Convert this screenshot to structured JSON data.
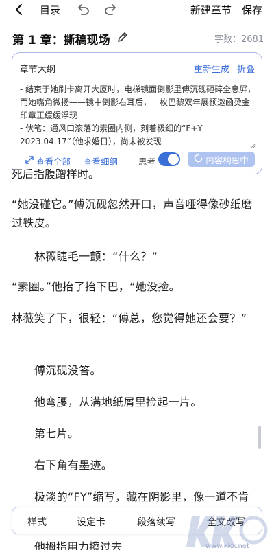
{
  "toolbar": {
    "toc_label": "目录",
    "new_chapter_label": "新建章节",
    "save_label": "保存"
  },
  "chapter": {
    "title": "第 1 章：撕稿现场",
    "word_count_label": "字数：",
    "word_count": "2681"
  },
  "outline": {
    "title": "章节大纲",
    "regenerate_label": "重新生成",
    "fold_label": "折叠",
    "lines": [
      "- 结束于她刷卡离开大厦时，电梯镜面倒影里傅沉砚砸碎全息屏，而她嘴角微扬——镜中倒影右耳后，一枚巴黎双年展预邀函烫金印章正缓缓浮现",
      "- 伏笔：通风口滚落的素圈内侧，刻着极细的“F+Y 2023.04.17”（他求婚日），尚未被发现"
    ],
    "view_all_label": "查看全部",
    "view_detail_label": "查看细纲",
    "think_label": "思考",
    "think_enabled": true,
    "idea_button_label": "内容构思中"
  },
  "body": {
    "cut_line": "死后指腹蹭样时。",
    "paragraphs": [
      "“她没碰它。”傅沉砚忽然开口，声音哑得像砂纸磨过铁皮。",
      "林薇睫毛一颤：“什么？”",
      "“素圈。”他抬了抬下巴，“她没捡。",
      "林薇笑了下，很轻：“傅总，您觉得她还会要？”",
      "傅沉砚没答。",
      "他弯腰，从满地纸屑里捡起一片。",
      "第七片。",
      "右下角有墨迹。",
      "极淡的“FY”缩写，藏在阴影里，像一道不肯"
    ],
    "partial_bottom_line": "他拇指用力擦过去"
  },
  "bottom_bar": {
    "items": [
      "样式",
      "设定卡",
      "段落续写",
      "全文改写"
    ]
  },
  "watermark": {
    "url": "www.kkx.net"
  },
  "colors": {
    "accent": "#3b6fd8",
    "card_border": "#aab8e8",
    "idea_button_bg": "#aec3ef"
  }
}
